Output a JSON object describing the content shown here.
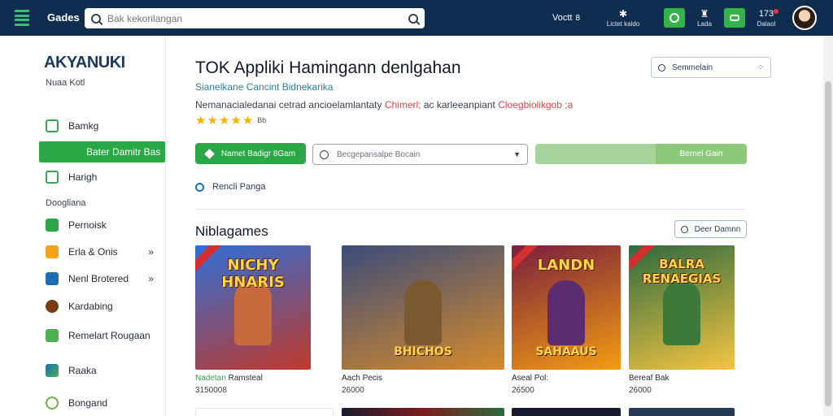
{
  "topbar": {
    "brand": "Gades",
    "search_placeholder": "Bak kekorilangan",
    "items": [
      {
        "label": "Voctt",
        "sub": "8"
      },
      {
        "label": "Lictet kaldo",
        "icon": "gear-icon"
      },
      {
        "label": "",
        "icon": "check-ring-icon"
      },
      {
        "label": "Lada",
        "icon": "trophy-icon"
      },
      {
        "label": "",
        "icon": "gamepad-icon"
      },
      {
        "label": "Dalaol",
        "count": "173"
      }
    ]
  },
  "sidebar": {
    "logo_main": "AKYANUKI",
    "logo_sub": "Nuaa Kotl",
    "items": [
      {
        "label": "Bamkg",
        "icon": "chart-icon",
        "color": "#3aa655"
      },
      {
        "label": "Bater Damitr Bas",
        "icon": "",
        "active": true
      },
      {
        "label": "Harigh",
        "icon": "window-icon",
        "color": "#3aa655"
      }
    ],
    "section": "Doogliana",
    "items2": [
      {
        "label": "Pernoisk",
        "icon": "grid-icon",
        "color": "#2aa846"
      },
      {
        "label": "Erla & Onis",
        "icon": "box-icon",
        "color": "#f4a21b",
        "chevron": "»"
      },
      {
        "label": "Nenl Brotered",
        "icon": "cube-icon",
        "color": "#1f6fb5",
        "chevron": "»"
      },
      {
        "label": "Kardabing",
        "icon": "mask-icon",
        "color": "#7a3b12"
      },
      {
        "label": "Remelart Rougaan",
        "icon": "castle-icon",
        "color": "#4caf50"
      },
      {
        "label": "Raaka",
        "icon": "map-icon",
        "color": "#1f6fb5"
      },
      {
        "label": "Bongand",
        "icon": "leaf-icon",
        "color": "#6ab04c"
      }
    ]
  },
  "main": {
    "title": "TOK Appliki Hamingann denlgahan",
    "subtitle": "Sianelkane Cancint Bidnekarika",
    "desc_a": "Nemanacialedanai cetrad ancioelamlantaty ",
    "desc_red1": "Chimerl;",
    "desc_b": " ac karleeanpiant ",
    "desc_red2": "Cloegbiolikgob ;a",
    "rating_value": "Bb",
    "rating_stars": 5,
    "search_side": "Semmelain",
    "search_side_expand": "⁘",
    "btn_primary": "Namet Badigr 8Gam",
    "select_value": "Becgepansalpe Bocain",
    "progress_label": "Bernel Gain",
    "progress_fraction": 0.57,
    "radio_label": "Rencli Panga",
    "section_title": "Niblagames",
    "btn_outline": "Deer Damnn",
    "cards": [
      {
        "name": "card-1",
        "top_text": "NICHY HNARIS",
        "bottom_text": "",
        "title_hl": "Nadetan",
        "title": " Ramsteal",
        "price": "3150008",
        "bg1": "#2f6fd6",
        "bg2": "#c0392b",
        "fig": "#c86b3c"
      },
      {
        "name": "card-2",
        "top_text": "",
        "bottom_text": "BHICHOS",
        "title_hl": "",
        "title": "Aach Pecis",
        "price": "26000",
        "bg1": "#3b4c7a",
        "bg2": "#d68a2a",
        "fig": "#7a5a2e"
      },
      {
        "name": "card-3",
        "top_text": "LANDN",
        "bottom_text": "SAHAAUS",
        "title_hl": "",
        "title": "Aseal Pol:",
        "price": "26500",
        "bg1": "#7a1f3d",
        "bg2": "#f39c12",
        "fig": "#5b2c6f"
      },
      {
        "name": "card-4",
        "top_text": "BALRA RENAEGIAS",
        "bottom_text": "",
        "title_hl": "",
        "title": "Bereaf Bak",
        "price": "26000",
        "bg1": "#2d6a3e",
        "bg2": "#f5c542",
        "fig": "#3d7a3a"
      }
    ]
  }
}
